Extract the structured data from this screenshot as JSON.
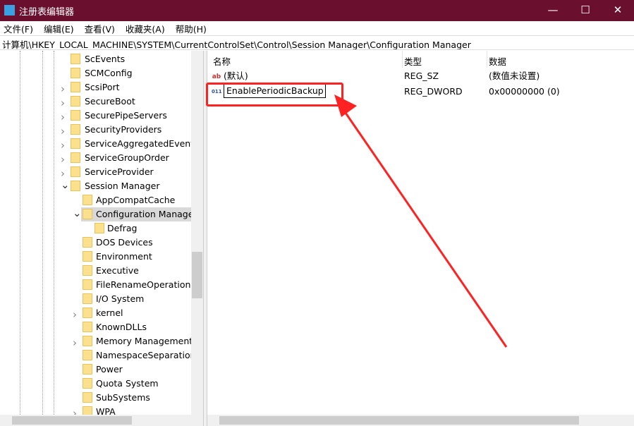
{
  "window": {
    "title": "注册表编辑器",
    "minimize": "—",
    "maximize": "☐",
    "close": "✕"
  },
  "menu": [
    "文件(F)",
    "编辑(E)",
    "查看(V)",
    "收藏夹(A)",
    "帮助(H)"
  ],
  "address": "计算机\\HKEY_LOCAL_MACHINE\\SYSTEM\\CurrentControlSet\\Control\\Session Manager\\Configuration Manager",
  "tree": [
    {
      "label": "ScEvents",
      "level": 0,
      "exp": ""
    },
    {
      "label": "SCMConfig",
      "level": 0,
      "exp": ""
    },
    {
      "label": "ScsiPort",
      "level": 0,
      "exp": ">"
    },
    {
      "label": "SecureBoot",
      "level": 0,
      "exp": ">"
    },
    {
      "label": "SecurePipeServers",
      "level": 0,
      "exp": ">"
    },
    {
      "label": "SecurityProviders",
      "level": 0,
      "exp": ">"
    },
    {
      "label": "ServiceAggregatedEvents",
      "level": 0,
      "exp": ">"
    },
    {
      "label": "ServiceGroupOrder",
      "level": 0,
      "exp": ">"
    },
    {
      "label": "ServiceProvider",
      "level": 0,
      "exp": ">"
    },
    {
      "label": "Session Manager",
      "level": 0,
      "exp": "v"
    },
    {
      "label": "AppCompatCache",
      "level": 1,
      "exp": ""
    },
    {
      "label": "Configuration Manager",
      "level": 1,
      "exp": "v",
      "selected": true
    },
    {
      "label": "Defrag",
      "level": 2,
      "exp": ""
    },
    {
      "label": "DOS Devices",
      "level": 1,
      "exp": ""
    },
    {
      "label": "Environment",
      "level": 1,
      "exp": ""
    },
    {
      "label": "Executive",
      "level": 1,
      "exp": ""
    },
    {
      "label": "FileRenameOperations",
      "level": 1,
      "exp": ""
    },
    {
      "label": "I/O System",
      "level": 1,
      "exp": ""
    },
    {
      "label": "kernel",
      "level": 1,
      "exp": ">"
    },
    {
      "label": "KnownDLLs",
      "level": 1,
      "exp": ""
    },
    {
      "label": "Memory Management",
      "level": 1,
      "exp": ">"
    },
    {
      "label": "NamespaceSeparation",
      "level": 1,
      "exp": ""
    },
    {
      "label": "Power",
      "level": 1,
      "exp": ""
    },
    {
      "label": "Quota System",
      "level": 1,
      "exp": ""
    },
    {
      "label": "SubSystems",
      "level": 1,
      "exp": ""
    },
    {
      "label": "WPA",
      "level": 1,
      "exp": ">"
    }
  ],
  "list": {
    "headers": [
      "名称",
      "类型",
      "数据"
    ],
    "rows": [
      {
        "icon": "string-value-icon",
        "name": "(默认)",
        "type": "REG_SZ",
        "data": "(数值未设置)"
      },
      {
        "icon": "dword-value-icon",
        "name": "EnablePeriodicBackup",
        "type": "REG_DWORD",
        "data": "0x00000000 (0)",
        "editing": true
      }
    ]
  },
  "annotation_color": "#f22222"
}
